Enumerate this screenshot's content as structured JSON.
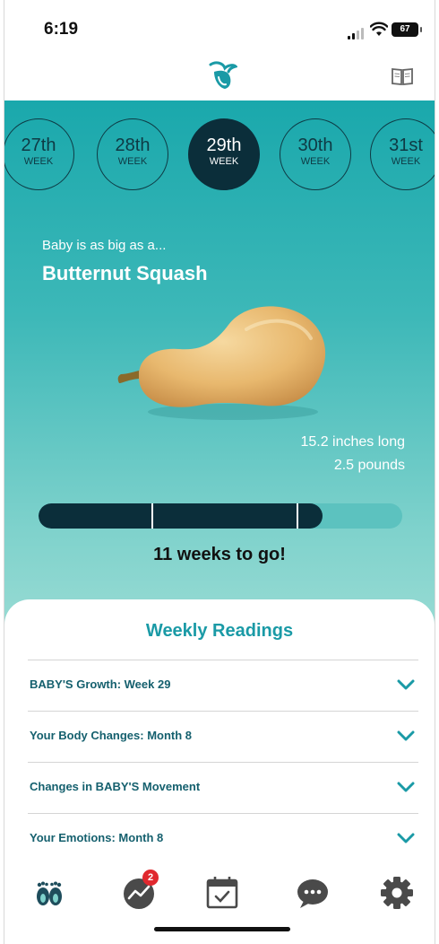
{
  "status_bar": {
    "time": "6:19",
    "battery": "67"
  },
  "header": {
    "logo_icon": "bird-logo-icon",
    "book_icon": "book-icon"
  },
  "weeks": [
    {
      "number": "27th",
      "label": "WEEK",
      "selected": false
    },
    {
      "number": "28th",
      "label": "WEEK",
      "selected": false
    },
    {
      "number": "29th",
      "label": "WEEK",
      "selected": true
    },
    {
      "number": "30th",
      "label": "WEEK",
      "selected": false
    },
    {
      "number": "31st",
      "label": "WEEK",
      "selected": false
    }
  ],
  "baby_size": {
    "intro": "Baby is as big as a...",
    "fruit": "Butternut Squash",
    "length": "15.2 inches long",
    "weight": "2.5 pounds"
  },
  "progress": {
    "fraction": 0.78,
    "trimester_marks": [
      0.31,
      0.71
    ],
    "label": "11 weeks to go!"
  },
  "readings": {
    "title": "Weekly Readings",
    "items": [
      {
        "label": "BABY'S Growth: Week 29"
      },
      {
        "label": "Your Body Changes: Month 8"
      },
      {
        "label": "Changes in BABY'S Movement"
      },
      {
        "label": "Your Emotions: Month 8"
      }
    ]
  },
  "tabbar": {
    "items": [
      {
        "icon": "baby-feet-icon"
      },
      {
        "icon": "chart-icon",
        "badge": "2"
      },
      {
        "icon": "calendar-check-icon"
      },
      {
        "icon": "chat-bubble-icon"
      },
      {
        "icon": "gear-icon"
      }
    ]
  },
  "colors": {
    "teal_top": "#1aa8ac",
    "teal_bottom": "#9adcd4",
    "navy": "#0b2e3a",
    "reading_text": "#15606e",
    "title_teal": "#1a9aa6",
    "icon_gray": "#4a4a4a",
    "badge_red": "#e0282e"
  }
}
